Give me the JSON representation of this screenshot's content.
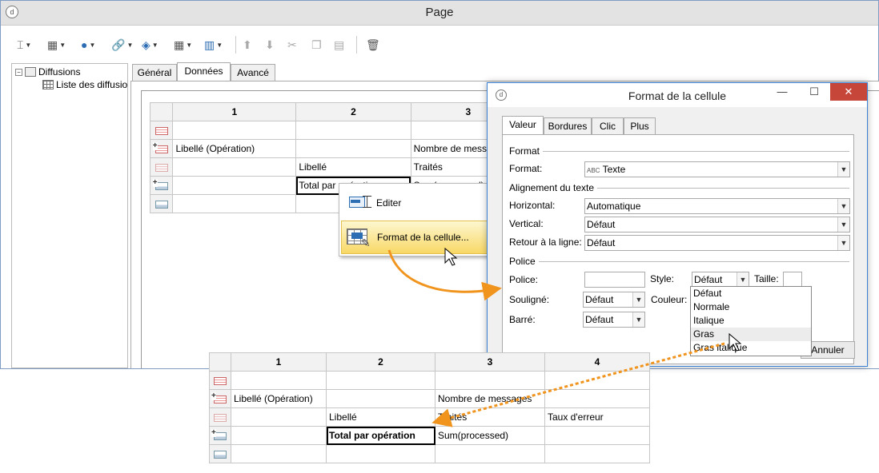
{
  "window": {
    "title": "Page",
    "icon_label": "d"
  },
  "tree": {
    "root": "Diffusions",
    "child": "Liste des diffusio"
  },
  "tabs": [
    {
      "label": "Général"
    },
    {
      "label": "Données"
    },
    {
      "label": "Avancé"
    }
  ],
  "grid": {
    "columns": [
      "1",
      "2",
      "3"
    ],
    "rows": [
      [
        "",
        "",
        ""
      ],
      [
        "Libellé (Opération)",
        "",
        "Nombre de messages"
      ],
      [
        "",
        "Libellé",
        "Traités"
      ],
      [
        "",
        "Total par opération",
        "Sum(processed)"
      ],
      [
        "",
        "",
        ""
      ]
    ]
  },
  "context_menu": {
    "items": [
      {
        "label": "Editer"
      },
      {
        "label": "Format de la cellule..."
      }
    ]
  },
  "dialog": {
    "title": "Format de la cellule",
    "tabs": [
      {
        "label": "Valeur"
      },
      {
        "label": "Bordures"
      },
      {
        "label": "Clic"
      },
      {
        "label": "Plus"
      }
    ],
    "sections": {
      "format": "Format",
      "alignment": "Alignement du texte",
      "police": "Police"
    },
    "format": {
      "label": "Format:",
      "value": "Texte",
      "badge": "ABC"
    },
    "horizontal": {
      "label": "Horizontal:",
      "value": "Automatique"
    },
    "vertical": {
      "label": "Vertical:",
      "value": "Défaut"
    },
    "wrap": {
      "label": "Retour à la ligne:",
      "value": "Défaut"
    },
    "police": {
      "label": "Police:",
      "value": ""
    },
    "style": {
      "label": "Style:",
      "value": "Défaut",
      "options": [
        "Défaut",
        "Normale",
        "Italique",
        "Gras",
        "Gras italique"
      ]
    },
    "taille": {
      "label": "Taille:",
      "value": ""
    },
    "souligne": {
      "label": "Souligné:",
      "value": "Défaut"
    },
    "couleur": {
      "label": "Couleur:"
    },
    "barre": {
      "label": "Barré:",
      "value": "Défaut"
    },
    "cancel_button": "Annuler"
  },
  "result_grid": {
    "columns": [
      "1",
      "2",
      "3",
      "4"
    ],
    "rows": [
      [
        "",
        "",
        "",
        ""
      ],
      [
        "Libellé (Opération)",
        "",
        "Nombre de messages",
        ""
      ],
      [
        "",
        "Libellé",
        "Traités",
        "Taux d'erreur"
      ],
      [
        "",
        "Total par opération",
        "Sum(processed)",
        ""
      ],
      [
        "",
        "",
        "",
        ""
      ]
    ]
  },
  "colors": {
    "arrow": "#f0941e",
    "highlight": "#f8d866",
    "close": "#c7463a"
  }
}
